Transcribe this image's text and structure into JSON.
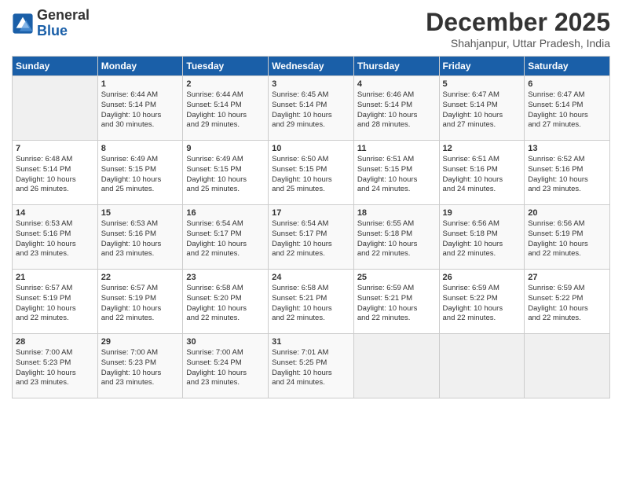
{
  "logo": {
    "line1": "General",
    "line2": "Blue"
  },
  "title": "December 2025",
  "subtitle": "Shahjanpur, Uttar Pradesh, India",
  "days_of_week": [
    "Sunday",
    "Monday",
    "Tuesday",
    "Wednesday",
    "Thursday",
    "Friday",
    "Saturday"
  ],
  "weeks": [
    [
      {
        "day": "",
        "info": ""
      },
      {
        "day": "1",
        "info": "Sunrise: 6:44 AM\nSunset: 5:14 PM\nDaylight: 10 hours\nand 30 minutes."
      },
      {
        "day": "2",
        "info": "Sunrise: 6:44 AM\nSunset: 5:14 PM\nDaylight: 10 hours\nand 29 minutes."
      },
      {
        "day": "3",
        "info": "Sunrise: 6:45 AM\nSunset: 5:14 PM\nDaylight: 10 hours\nand 29 minutes."
      },
      {
        "day": "4",
        "info": "Sunrise: 6:46 AM\nSunset: 5:14 PM\nDaylight: 10 hours\nand 28 minutes."
      },
      {
        "day": "5",
        "info": "Sunrise: 6:47 AM\nSunset: 5:14 PM\nDaylight: 10 hours\nand 27 minutes."
      },
      {
        "day": "6",
        "info": "Sunrise: 6:47 AM\nSunset: 5:14 PM\nDaylight: 10 hours\nand 27 minutes."
      }
    ],
    [
      {
        "day": "7",
        "info": "Sunrise: 6:48 AM\nSunset: 5:14 PM\nDaylight: 10 hours\nand 26 minutes."
      },
      {
        "day": "8",
        "info": "Sunrise: 6:49 AM\nSunset: 5:15 PM\nDaylight: 10 hours\nand 25 minutes."
      },
      {
        "day": "9",
        "info": "Sunrise: 6:49 AM\nSunset: 5:15 PM\nDaylight: 10 hours\nand 25 minutes."
      },
      {
        "day": "10",
        "info": "Sunrise: 6:50 AM\nSunset: 5:15 PM\nDaylight: 10 hours\nand 25 minutes."
      },
      {
        "day": "11",
        "info": "Sunrise: 6:51 AM\nSunset: 5:15 PM\nDaylight: 10 hours\nand 24 minutes."
      },
      {
        "day": "12",
        "info": "Sunrise: 6:51 AM\nSunset: 5:16 PM\nDaylight: 10 hours\nand 24 minutes."
      },
      {
        "day": "13",
        "info": "Sunrise: 6:52 AM\nSunset: 5:16 PM\nDaylight: 10 hours\nand 23 minutes."
      }
    ],
    [
      {
        "day": "14",
        "info": "Sunrise: 6:53 AM\nSunset: 5:16 PM\nDaylight: 10 hours\nand 23 minutes."
      },
      {
        "day": "15",
        "info": "Sunrise: 6:53 AM\nSunset: 5:16 PM\nDaylight: 10 hours\nand 23 minutes."
      },
      {
        "day": "16",
        "info": "Sunrise: 6:54 AM\nSunset: 5:17 PM\nDaylight: 10 hours\nand 22 minutes."
      },
      {
        "day": "17",
        "info": "Sunrise: 6:54 AM\nSunset: 5:17 PM\nDaylight: 10 hours\nand 22 minutes."
      },
      {
        "day": "18",
        "info": "Sunrise: 6:55 AM\nSunset: 5:18 PM\nDaylight: 10 hours\nand 22 minutes."
      },
      {
        "day": "19",
        "info": "Sunrise: 6:56 AM\nSunset: 5:18 PM\nDaylight: 10 hours\nand 22 minutes."
      },
      {
        "day": "20",
        "info": "Sunrise: 6:56 AM\nSunset: 5:19 PM\nDaylight: 10 hours\nand 22 minutes."
      }
    ],
    [
      {
        "day": "21",
        "info": "Sunrise: 6:57 AM\nSunset: 5:19 PM\nDaylight: 10 hours\nand 22 minutes."
      },
      {
        "day": "22",
        "info": "Sunrise: 6:57 AM\nSunset: 5:19 PM\nDaylight: 10 hours\nand 22 minutes."
      },
      {
        "day": "23",
        "info": "Sunrise: 6:58 AM\nSunset: 5:20 PM\nDaylight: 10 hours\nand 22 minutes."
      },
      {
        "day": "24",
        "info": "Sunrise: 6:58 AM\nSunset: 5:21 PM\nDaylight: 10 hours\nand 22 minutes."
      },
      {
        "day": "25",
        "info": "Sunrise: 6:59 AM\nSunset: 5:21 PM\nDaylight: 10 hours\nand 22 minutes."
      },
      {
        "day": "26",
        "info": "Sunrise: 6:59 AM\nSunset: 5:22 PM\nDaylight: 10 hours\nand 22 minutes."
      },
      {
        "day": "27",
        "info": "Sunrise: 6:59 AM\nSunset: 5:22 PM\nDaylight: 10 hours\nand 22 minutes."
      }
    ],
    [
      {
        "day": "28",
        "info": "Sunrise: 7:00 AM\nSunset: 5:23 PM\nDaylight: 10 hours\nand 23 minutes."
      },
      {
        "day": "29",
        "info": "Sunrise: 7:00 AM\nSunset: 5:23 PM\nDaylight: 10 hours\nand 23 minutes."
      },
      {
        "day": "30",
        "info": "Sunrise: 7:00 AM\nSunset: 5:24 PM\nDaylight: 10 hours\nand 23 minutes."
      },
      {
        "day": "31",
        "info": "Sunrise: 7:01 AM\nSunset: 5:25 PM\nDaylight: 10 hours\nand 24 minutes."
      },
      {
        "day": "",
        "info": ""
      },
      {
        "day": "",
        "info": ""
      },
      {
        "day": "",
        "info": ""
      }
    ]
  ]
}
